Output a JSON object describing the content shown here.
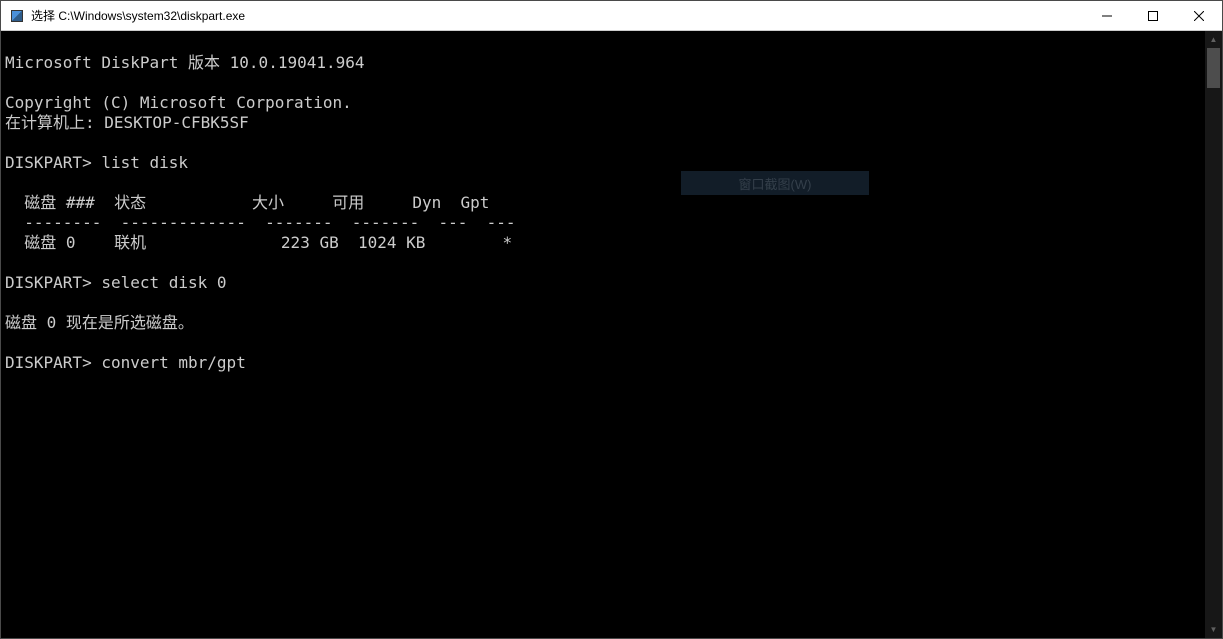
{
  "window": {
    "title": "选择 C:\\Windows\\system32\\diskpart.exe"
  },
  "console": {
    "lines": [
      "",
      "Microsoft DiskPart 版本 10.0.19041.964",
      "",
      "Copyright (C) Microsoft Corporation.",
      "在计算机上: DESKTOP-CFBK5SF",
      "",
      "DISKPART> list disk",
      "",
      "  磁盘 ###  状态           大小     可用     Dyn  Gpt",
      "  --------  -------------  -------  -------  ---  ---",
      "  磁盘 0    联机              223 GB  1024 KB        *",
      "",
      "DISKPART> select disk 0",
      "",
      "磁盘 0 现在是所选磁盘。",
      "",
      "DISKPART> convert mbr/gpt"
    ]
  },
  "overlay": {
    "label": "窗口截图(W)"
  }
}
